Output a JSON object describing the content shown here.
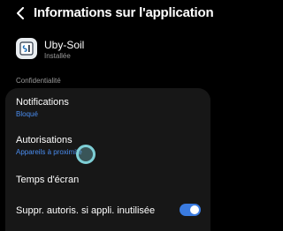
{
  "header": {
    "title": "Informations sur l'application"
  },
  "app": {
    "name": "Uby-Soil",
    "status": "Installée",
    "icon": "uby-soil-app-icon"
  },
  "section": {
    "label": "Confidentialité"
  },
  "items": [
    {
      "title": "Notifications",
      "subtitle": "Bloqué"
    },
    {
      "title": "Autorisations",
      "subtitle": "Appareils à proximité"
    },
    {
      "title": "Temps d'écran"
    },
    {
      "title": "Suppr. autoris. si appli. inutilisée",
      "toggle_on": true
    }
  ],
  "colors": {
    "accent": "#3a7be0",
    "link": "#4a8df0",
    "card": "#171717",
    "background": "#000000"
  }
}
